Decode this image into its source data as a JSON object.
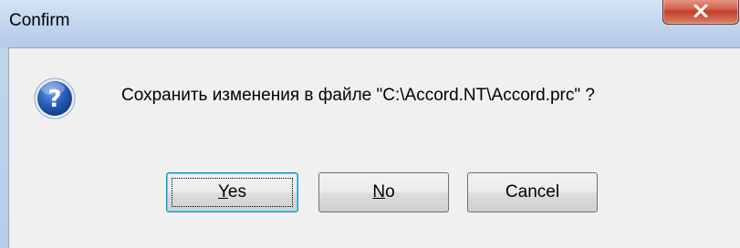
{
  "window": {
    "title": "Confirm"
  },
  "titlebar": {
    "close_icon": "close-x-icon"
  },
  "dialog": {
    "icon": "question-icon",
    "message": "Сохранить изменения в файле \"C:\\Accord.NT\\Accord.prc\" ?"
  },
  "buttons": {
    "yes": {
      "mnemonic": "Y",
      "rest": "es"
    },
    "no": {
      "mnemonic": "N",
      "rest": "o"
    },
    "cancel": {
      "label": "Cancel"
    }
  },
  "colors": {
    "title_bar": "#c3d7ee",
    "client_bg": "#f0f0f0",
    "close_button": "#c4402a",
    "icon_blue": "#1e4fa8"
  }
}
